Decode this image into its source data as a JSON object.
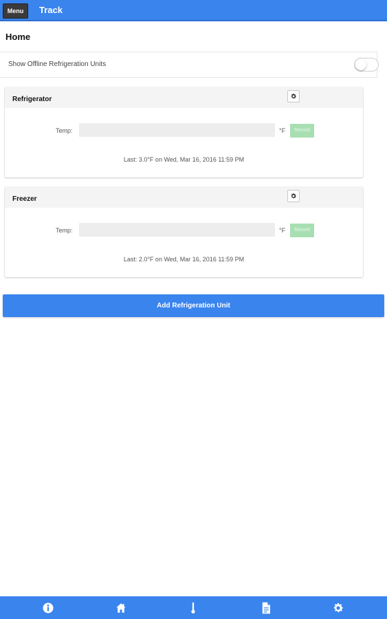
{
  "header": {
    "menu_label": "Menu",
    "title": "Track"
  },
  "breadcrumb": "Home",
  "offline_toggle": {
    "label": "Show Offline Refrigeration Units",
    "enabled": false
  },
  "units": [
    {
      "name": "Refrigerator",
      "temp_label": "Temp:",
      "temp_value": "",
      "unit": "°F",
      "record_label": "Record",
      "last_reading": "Last: 3.0°F on Wed, Mar 16, 2016 11:59 PM"
    },
    {
      "name": "Freezer",
      "temp_label": "Temp:",
      "temp_value": "",
      "unit": "°F",
      "record_label": "Record",
      "last_reading": "Last: 2.0°F on Wed, Mar 16, 2016 11:59 PM"
    }
  ],
  "add_button_label": "Add Refrigeration Unit",
  "bottom_nav": [
    {
      "icon": "info-icon"
    },
    {
      "icon": "home-icon"
    },
    {
      "icon": "thermometer-icon"
    },
    {
      "icon": "document-icon"
    },
    {
      "icon": "gear-icon"
    }
  ],
  "colors": {
    "primary": "#3a84ee",
    "record_button": "#a8dfb2",
    "input_bg": "#ededed",
    "card_header_bg": "#f4f4f4"
  }
}
